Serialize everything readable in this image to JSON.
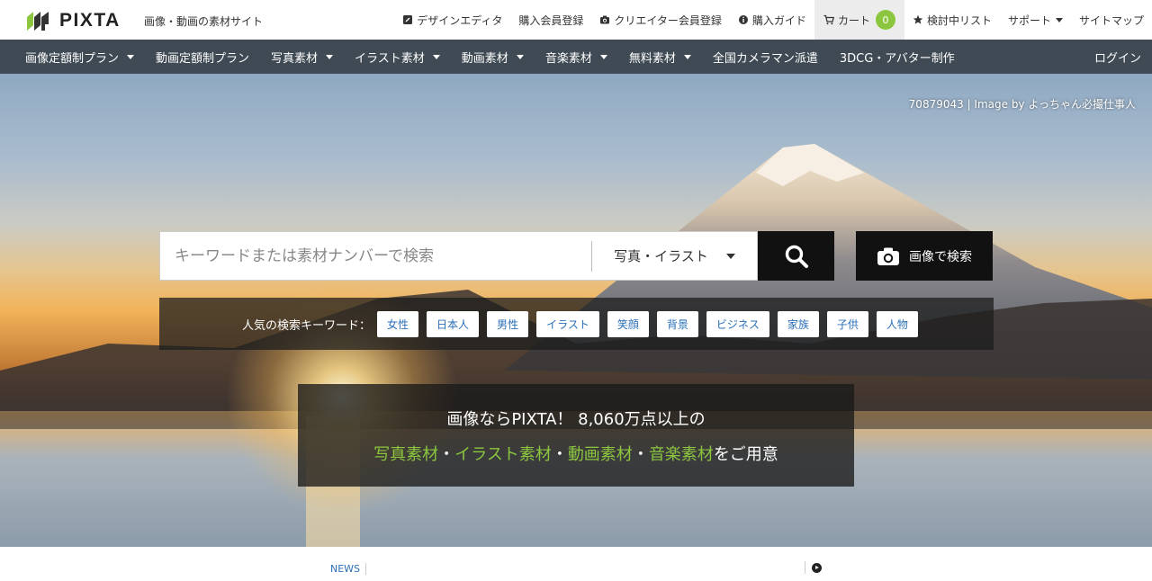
{
  "header": {
    "logo_text": "PIXTA",
    "tagline": "画像・動画の素材サイト",
    "nav": [
      {
        "label": "デザインエディタ",
        "icon": "edit-icon"
      },
      {
        "label": "購入会員登録"
      },
      {
        "label": "クリエイター会員登録",
        "icon": "camera-icon"
      },
      {
        "label": "購入ガイド",
        "icon": "info-icon"
      },
      {
        "label": "カート",
        "icon": "cart-icon",
        "badge": "0"
      },
      {
        "label": "検討中リスト",
        "icon": "star-icon"
      },
      {
        "label": "サポート",
        "has_dropdown": true
      },
      {
        "label": "サイトマップ"
      }
    ]
  },
  "category_nav": {
    "items": [
      {
        "label": "画像定額制プラン",
        "has_dropdown": true
      },
      {
        "label": "動画定額制プラン",
        "has_dropdown": false
      },
      {
        "label": "写真素材",
        "has_dropdown": true
      },
      {
        "label": "イラスト素材",
        "has_dropdown": true
      },
      {
        "label": "動画素材",
        "has_dropdown": true
      },
      {
        "label": "音楽素材",
        "has_dropdown": true
      },
      {
        "label": "無料素材",
        "has_dropdown": true
      },
      {
        "label": "全国カメラマン派遣",
        "has_dropdown": false
      },
      {
        "label": "3DCG・アバター制作",
        "has_dropdown": false
      }
    ],
    "login_label": "ログイン"
  },
  "hero": {
    "credit_id": "70879043",
    "credit_sep": " | ",
    "credit_text": "Image by よっちゃん必撮仕事人",
    "search": {
      "placeholder": "キーワードまたは素材ナンバーで検索",
      "type_selected": "写真・イラスト",
      "image_search_label": "画像で検索"
    },
    "popular_label": "人気の検索キーワード：",
    "keywords": [
      "女性",
      "日本人",
      "男性",
      "イラスト",
      "笑顔",
      "背景",
      "ビジネス",
      "家族",
      "子供",
      "人物"
    ],
    "promo_line1": "画像ならPIXTA！ 8,060万点以上の",
    "promo_hl1": "写真素材",
    "promo_sep1": "・",
    "promo_hl2": "イラスト素材",
    "promo_sep2": "・",
    "promo_hl3": "動画素材",
    "promo_sep3": "・",
    "promo_hl4": "音楽素材",
    "promo_tail": "をご用意"
  },
  "news": {
    "label": "NEWS"
  },
  "colors": {
    "accent_green": "#8cc63f",
    "nav_bg": "#3f4a54",
    "link_blue": "#2a6fb8"
  }
}
